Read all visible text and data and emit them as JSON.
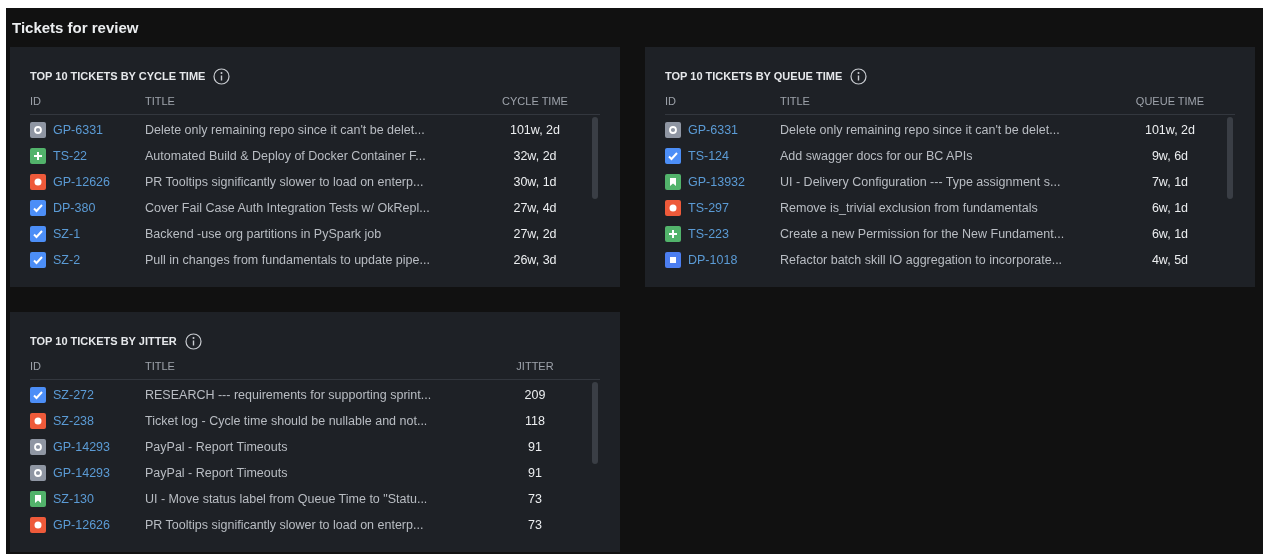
{
  "page_title": "Tickets for review",
  "panels": [
    {
      "title": "TOP 10 TICKETS BY CYCLE TIME",
      "columns": [
        "ID",
        "TITLE",
        "CYCLE TIME"
      ],
      "rows": [
        {
          "kind": "chore",
          "id": "GP-6331",
          "title": "Delete only remaining repo since it can't be delet...",
          "value": "101w, 2d"
        },
        {
          "kind": "feature",
          "id": "TS-22",
          "title": "Automated Build & Deploy of Docker Container F...",
          "value": "32w, 2d"
        },
        {
          "kind": "bug",
          "id": "GP-12626",
          "title": "PR Tooltips significantly slower to load on enterp...",
          "value": "30w, 1d"
        },
        {
          "kind": "task",
          "id": "DP-380",
          "title": "Cover Fail Case Auth Integration Tests w/ OkRepl...",
          "value": "27w, 4d"
        },
        {
          "kind": "task",
          "id": "SZ-1",
          "title": "Backend -use org partitions in PySpark job",
          "value": "27w, 2d"
        },
        {
          "kind": "task",
          "id": "SZ-2",
          "title": "Pull in changes from fundamentals to update pipe...",
          "value": "26w, 3d"
        }
      ]
    },
    {
      "title": "TOP 10 TICKETS BY QUEUE TIME",
      "columns": [
        "ID",
        "TITLE",
        "QUEUE TIME"
      ],
      "rows": [
        {
          "kind": "chore",
          "id": "GP-6331",
          "title": "Delete only remaining repo since it can't be delet...",
          "value": "101w, 2d"
        },
        {
          "kind": "task",
          "id": "TS-124",
          "title": "Add swagger docs for our BC APIs",
          "value": "9w, 6d"
        },
        {
          "kind": "story",
          "id": "GP-13932",
          "title": "UI - Delivery Configuration --- Type assignment s...",
          "value": "7w, 1d"
        },
        {
          "kind": "bug",
          "id": "TS-297",
          "title": "Remove is_trivial exclusion from fundamentals",
          "value": "6w, 1d"
        },
        {
          "kind": "feature",
          "id": "TS-223",
          "title": "Create a new Permission for the New Fundament...",
          "value": "6w, 1d"
        },
        {
          "kind": "epic",
          "id": "DP-1018",
          "title": "Refactor batch skill IO aggregation to incorporate...",
          "value": "4w, 5d"
        }
      ]
    },
    {
      "title": "TOP 10 TICKETS BY JITTER",
      "columns": [
        "ID",
        "TITLE",
        "JITTER"
      ],
      "rows": [
        {
          "kind": "task",
          "id": "SZ-272",
          "title": "RESEARCH --- requirements for supporting sprint...",
          "value": "209"
        },
        {
          "kind": "bug",
          "id": "SZ-238",
          "title": "Ticket log - Cycle time should be nullable and not...",
          "value": "118"
        },
        {
          "kind": "chore",
          "id": "GP-14293",
          "title": "PayPal - Report Timeouts",
          "value": "91"
        },
        {
          "kind": "chore",
          "id": "GP-14293",
          "title": "PayPal - Report Timeouts",
          "value": "91"
        },
        {
          "kind": "story",
          "id": "SZ-130",
          "title": "UI - Move status label from Queue Time to \"Statu...",
          "value": "73"
        },
        {
          "kind": "bug",
          "id": "GP-12626",
          "title": "PR Tooltips significantly slower to load on enterp...",
          "value": "73"
        }
      ]
    }
  ]
}
